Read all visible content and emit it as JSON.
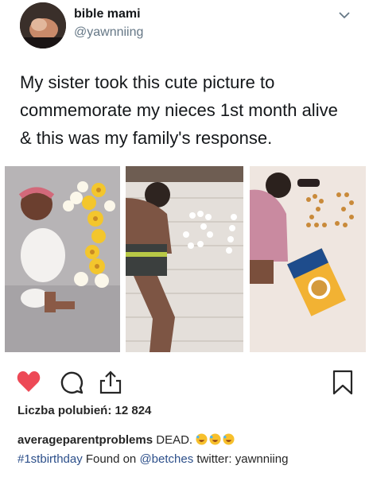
{
  "tweet": {
    "display_name": "bible mami",
    "handle": "@yawnniing",
    "text": "My sister took this cute picture to commemorate my nieces 1st month alive & this was my family's response."
  },
  "post": {
    "likes_label": "Liczba polubień: 12 824",
    "caption": {
      "username": "averageparentproblems",
      "text": "DEAD.",
      "hashtag": "#1stbirthday",
      "found_on": "Found on",
      "mention": "@betches",
      "twitter_text": "twitter: yawnniing"
    }
  },
  "icons": {
    "like": "heart-icon",
    "comment": "comment-icon",
    "share": "share-icon",
    "save": "bookmark-icon",
    "more": "chevron-down-icon"
  },
  "colors": {
    "heart": "#ed4956",
    "link": "#2c4f8a",
    "handle": "#657786"
  }
}
